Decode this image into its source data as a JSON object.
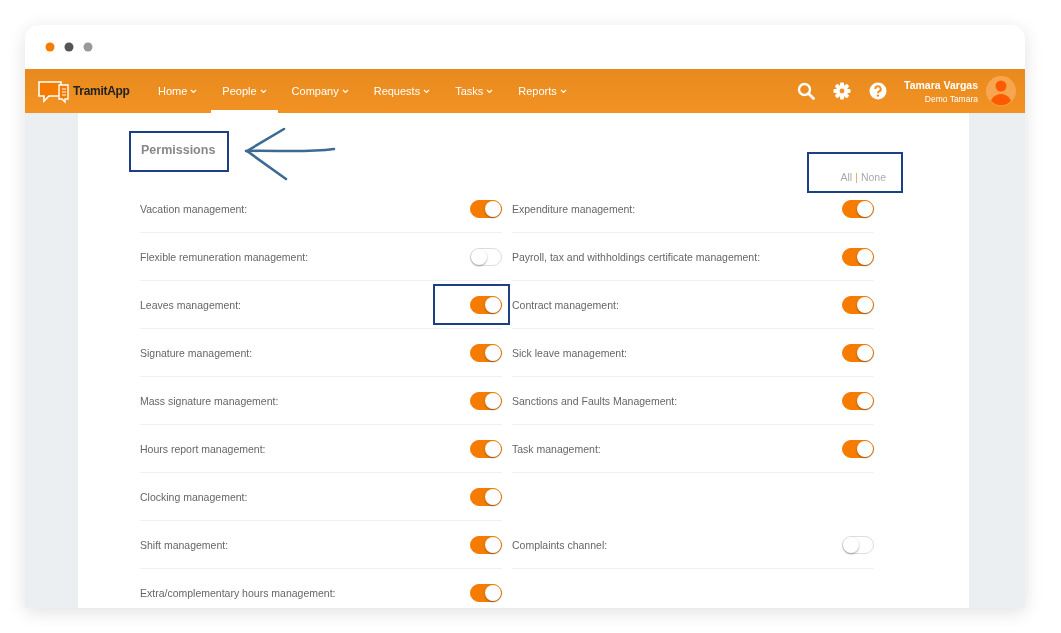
{
  "app": {
    "logo": "TramitApp"
  },
  "nav": [
    {
      "label": "Home",
      "selected": false
    },
    {
      "label": "People",
      "selected": true
    },
    {
      "label": "Company",
      "selected": false
    },
    {
      "label": "Requests",
      "selected": false
    },
    {
      "label": "Tasks",
      "selected": false
    },
    {
      "label": "Reports",
      "selected": false
    }
  ],
  "user": {
    "name": "Tamara Vargas",
    "company": "Demo Tamara"
  },
  "permissions": {
    "title": "Permissions",
    "title_highlighted": true,
    "select_all": {
      "all": "All",
      "separator": "|",
      "none": "None",
      "highlighted": true
    },
    "rows": [
      {
        "cells": [
          {
            "label": "Vacation management:",
            "on": true,
            "highlighted": false
          },
          {
            "label": "Expenditure management:",
            "on": true,
            "highlighted": false
          }
        ]
      },
      {
        "cells": [
          {
            "label": "Flexible remuneration management:",
            "on": false,
            "highlighted": false
          },
          {
            "label": "Payroll, tax and withholdings certificate management:",
            "on": true,
            "highlighted": false
          }
        ]
      },
      {
        "cells": [
          {
            "label": "Leaves management:",
            "on": true,
            "highlighted": true
          },
          {
            "label": "Contract management:",
            "on": true,
            "highlighted": false
          }
        ]
      },
      {
        "cells": [
          {
            "label": "Signature management:",
            "on": true,
            "highlighted": false
          },
          {
            "label": "Sick leave management:",
            "on": true,
            "highlighted": false
          }
        ]
      },
      {
        "cells": [
          {
            "label": "Mass signature management:",
            "on": true,
            "highlighted": false
          },
          {
            "label": "Sanctions and Faults Management:",
            "on": true,
            "highlighted": false
          }
        ]
      },
      {
        "cells": [
          {
            "label": "Hours report management:",
            "on": true,
            "highlighted": false
          },
          {
            "label": "Task management:",
            "on": true,
            "highlighted": false
          }
        ]
      },
      {
        "cells": [
          {
            "label": "Clocking management:",
            "on": true,
            "highlighted": false
          }
        ]
      },
      {
        "cells": [
          {
            "label": "Shift management:",
            "on": true,
            "highlighted": false
          },
          {
            "label": "Complaints channel:",
            "on": false,
            "highlighted": false
          }
        ]
      },
      {
        "cells": [
          {
            "label": "Extra/complementary hours management:",
            "on": true,
            "highlighted": false
          }
        ]
      }
    ]
  }
}
